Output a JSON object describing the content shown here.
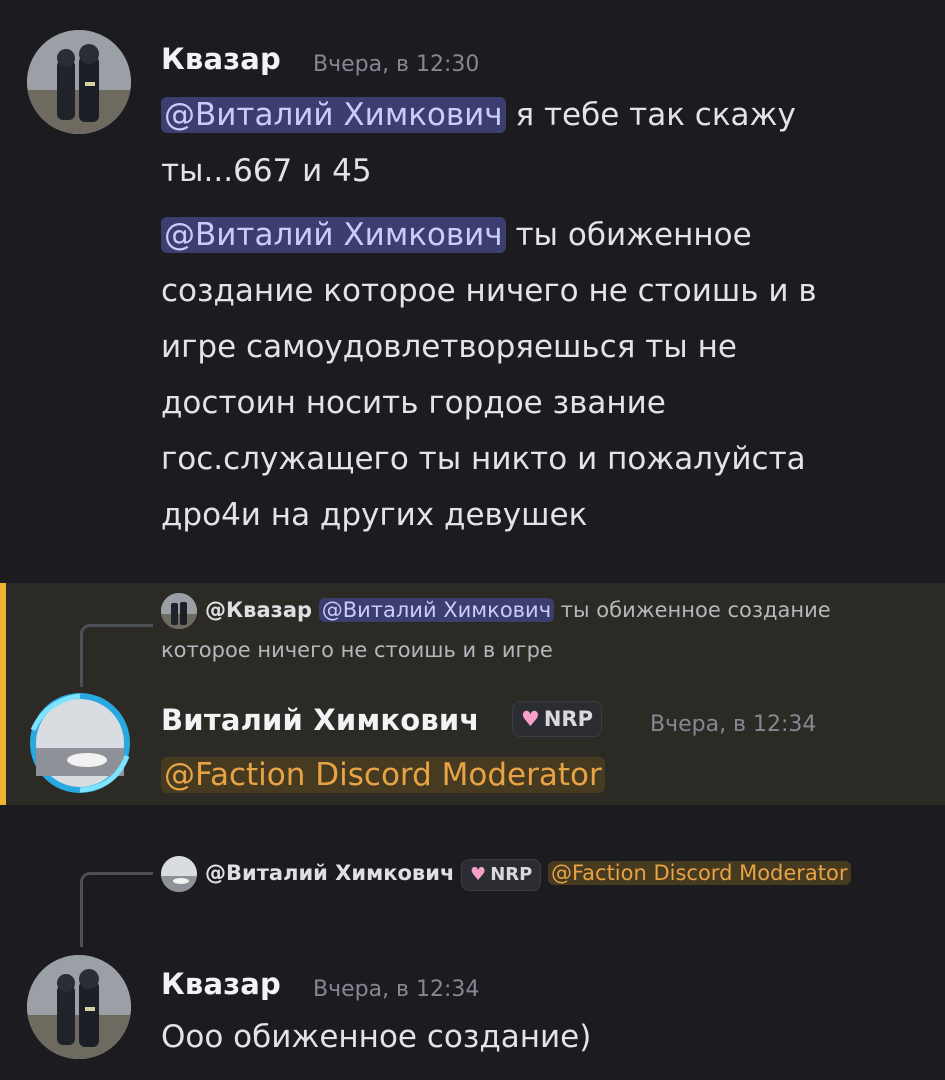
{
  "messages": [
    {
      "author": "Квазар",
      "timestamp": "Вчера, в 12:30",
      "lines": [
        {
          "mention": "@Виталий Химкович",
          "text": " я тебе так скажу ты...667 и 45"
        },
        {
          "mention": "@Виталий Химкович",
          "text": " ты обиженное создание которое ничего не стоишь и в игре самоудовлетворяешься ты не достоин носить гордое звание гос.служащего ты никто и пожалуйста дро4и на других девушек"
        }
      ]
    },
    {
      "reply": {
        "author": "@Квазар",
        "mention": "@Виталий Химкович",
        "text": " ты обиженное создание которое ничего не стоишь и в игре"
      },
      "author": "Виталий Химкович",
      "badge": "NRP",
      "timestamp": "Вчера, в 12:34",
      "role_mention": "@Faction Discord Moderator"
    },
    {
      "reply": {
        "author": "@Виталий Химкович",
        "badge": "NRP",
        "role_mention": "@Faction Discord Moderator"
      },
      "author": "Квазар",
      "timestamp": "Вчера, в 12:34",
      "text": "Ооо обиженное создание)"
    }
  ],
  "colors": {
    "background": "#1b1b20",
    "highlight": "#2c2a25",
    "highlight_bar": "#f0b232",
    "mention_bg": "#3b3e6e",
    "mention_text": "#c9cdfb",
    "role_mention": "#e8a344"
  },
  "icons": {
    "badge": "heart-icon"
  }
}
